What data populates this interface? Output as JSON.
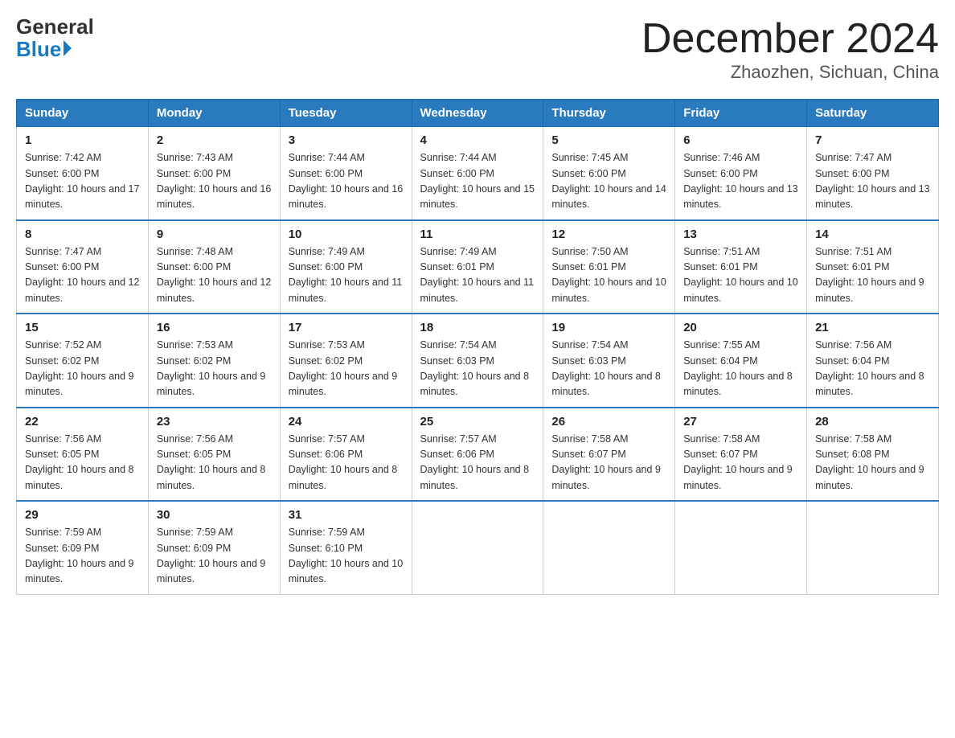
{
  "header": {
    "logo_general": "General",
    "logo_blue": "Blue",
    "month_title": "December 2024",
    "location": "Zhaozhen, Sichuan, China"
  },
  "weekdays": [
    "Sunday",
    "Monday",
    "Tuesday",
    "Wednesday",
    "Thursday",
    "Friday",
    "Saturday"
  ],
  "weeks": [
    [
      {
        "day": "1",
        "sunrise": "7:42 AM",
        "sunset": "6:00 PM",
        "daylight": "10 hours and 17 minutes."
      },
      {
        "day": "2",
        "sunrise": "7:43 AM",
        "sunset": "6:00 PM",
        "daylight": "10 hours and 16 minutes."
      },
      {
        "day": "3",
        "sunrise": "7:44 AM",
        "sunset": "6:00 PM",
        "daylight": "10 hours and 16 minutes."
      },
      {
        "day": "4",
        "sunrise": "7:44 AM",
        "sunset": "6:00 PM",
        "daylight": "10 hours and 15 minutes."
      },
      {
        "day": "5",
        "sunrise": "7:45 AM",
        "sunset": "6:00 PM",
        "daylight": "10 hours and 14 minutes."
      },
      {
        "day": "6",
        "sunrise": "7:46 AM",
        "sunset": "6:00 PM",
        "daylight": "10 hours and 13 minutes."
      },
      {
        "day": "7",
        "sunrise": "7:47 AM",
        "sunset": "6:00 PM",
        "daylight": "10 hours and 13 minutes."
      }
    ],
    [
      {
        "day": "8",
        "sunrise": "7:47 AM",
        "sunset": "6:00 PM",
        "daylight": "10 hours and 12 minutes."
      },
      {
        "day": "9",
        "sunrise": "7:48 AM",
        "sunset": "6:00 PM",
        "daylight": "10 hours and 12 minutes."
      },
      {
        "day": "10",
        "sunrise": "7:49 AM",
        "sunset": "6:00 PM",
        "daylight": "10 hours and 11 minutes."
      },
      {
        "day": "11",
        "sunrise": "7:49 AM",
        "sunset": "6:01 PM",
        "daylight": "10 hours and 11 minutes."
      },
      {
        "day": "12",
        "sunrise": "7:50 AM",
        "sunset": "6:01 PM",
        "daylight": "10 hours and 10 minutes."
      },
      {
        "day": "13",
        "sunrise": "7:51 AM",
        "sunset": "6:01 PM",
        "daylight": "10 hours and 10 minutes."
      },
      {
        "day": "14",
        "sunrise": "7:51 AM",
        "sunset": "6:01 PM",
        "daylight": "10 hours and 9 minutes."
      }
    ],
    [
      {
        "day": "15",
        "sunrise": "7:52 AM",
        "sunset": "6:02 PM",
        "daylight": "10 hours and 9 minutes."
      },
      {
        "day": "16",
        "sunrise": "7:53 AM",
        "sunset": "6:02 PM",
        "daylight": "10 hours and 9 minutes."
      },
      {
        "day": "17",
        "sunrise": "7:53 AM",
        "sunset": "6:02 PM",
        "daylight": "10 hours and 9 minutes."
      },
      {
        "day": "18",
        "sunrise": "7:54 AM",
        "sunset": "6:03 PM",
        "daylight": "10 hours and 8 minutes."
      },
      {
        "day": "19",
        "sunrise": "7:54 AM",
        "sunset": "6:03 PM",
        "daylight": "10 hours and 8 minutes."
      },
      {
        "day": "20",
        "sunrise": "7:55 AM",
        "sunset": "6:04 PM",
        "daylight": "10 hours and 8 minutes."
      },
      {
        "day": "21",
        "sunrise": "7:56 AM",
        "sunset": "6:04 PM",
        "daylight": "10 hours and 8 minutes."
      }
    ],
    [
      {
        "day": "22",
        "sunrise": "7:56 AM",
        "sunset": "6:05 PM",
        "daylight": "10 hours and 8 minutes."
      },
      {
        "day": "23",
        "sunrise": "7:56 AM",
        "sunset": "6:05 PM",
        "daylight": "10 hours and 8 minutes."
      },
      {
        "day": "24",
        "sunrise": "7:57 AM",
        "sunset": "6:06 PM",
        "daylight": "10 hours and 8 minutes."
      },
      {
        "day": "25",
        "sunrise": "7:57 AM",
        "sunset": "6:06 PM",
        "daylight": "10 hours and 8 minutes."
      },
      {
        "day": "26",
        "sunrise": "7:58 AM",
        "sunset": "6:07 PM",
        "daylight": "10 hours and 9 minutes."
      },
      {
        "day": "27",
        "sunrise": "7:58 AM",
        "sunset": "6:07 PM",
        "daylight": "10 hours and 9 minutes."
      },
      {
        "day": "28",
        "sunrise": "7:58 AM",
        "sunset": "6:08 PM",
        "daylight": "10 hours and 9 minutes."
      }
    ],
    [
      {
        "day": "29",
        "sunrise": "7:59 AM",
        "sunset": "6:09 PM",
        "daylight": "10 hours and 9 minutes."
      },
      {
        "day": "30",
        "sunrise": "7:59 AM",
        "sunset": "6:09 PM",
        "daylight": "10 hours and 9 minutes."
      },
      {
        "day": "31",
        "sunrise": "7:59 AM",
        "sunset": "6:10 PM",
        "daylight": "10 hours and 10 minutes."
      },
      null,
      null,
      null,
      null
    ]
  ],
  "labels": {
    "sunrise_prefix": "Sunrise: ",
    "sunset_prefix": "Sunset: ",
    "daylight_prefix": "Daylight: "
  }
}
